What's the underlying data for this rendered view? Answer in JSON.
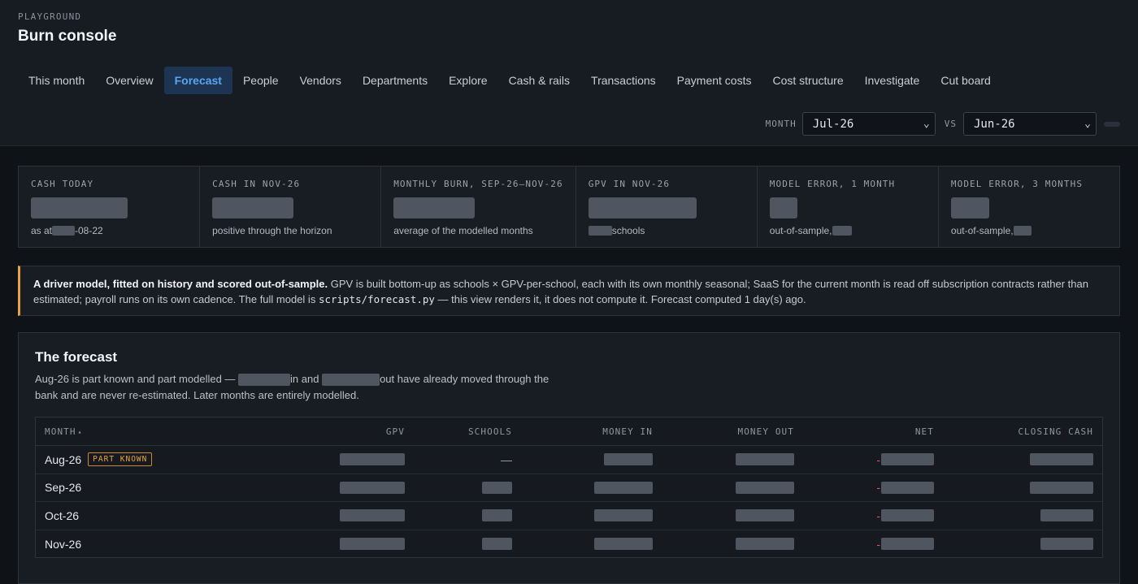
{
  "header": {
    "eyebrow": "PLAYGROUND",
    "title": "Burn console"
  },
  "nav": {
    "tabs": [
      "This month",
      "Overview",
      "Forecast",
      "People",
      "Vendors",
      "Departments",
      "Explore",
      "Cash & rails",
      "Transactions",
      "Payment costs",
      "Cost structure",
      "Investigate",
      "Cut board"
    ],
    "active": "Forecast"
  },
  "filters": {
    "month_label": "MONTH",
    "month_value": "Jul-26",
    "vs_label": "VS",
    "vs_value": "Jun-26"
  },
  "metrics": [
    {
      "label": "CASH TODAY",
      "sub_pre": "as at ",
      "sub_post": "-08-22"
    },
    {
      "label": "CASH IN NOV-26",
      "sub_pre": "positive through the horizon",
      "sub_post": ""
    },
    {
      "label": "MONTHLY BURN, SEP-26–NOV-26",
      "sub_pre": "average of the modelled months",
      "sub_post": ""
    },
    {
      "label": "GPV IN NOV-26",
      "sub_pre": "",
      "sub_post": " schools"
    },
    {
      "label": "MODEL ERROR, 1 MONTH",
      "sub_pre": "out-of-sample, ",
      "sub_post": ""
    },
    {
      "label": "MODEL ERROR, 3 MONTHS",
      "sub_pre": "out-of-sample, ",
      "sub_post": ""
    }
  ],
  "note": {
    "lead": "A driver model, fitted on history and scored out-of-sample.",
    "body1": " GPV is built bottom-up as schools × GPV-per-school, each with its own monthly seasonal; SaaS for the current month is read off subscription contracts rather than estimated; payroll runs on its own cadence. The full model is ",
    "code": "scripts/forecast.py",
    "body2": " — this view renders it, it does not compute it. Forecast computed 1 day(s) ago."
  },
  "forecast": {
    "title": "The forecast",
    "desc_1": "Aug-26 is part known and part modelled — ",
    "desc_2": "in and ",
    "desc_3": "out have already moved through the bank and are never re-estimated. Later months are entirely modelled.",
    "columns": [
      "MONTH",
      "GPV",
      "SCHOOLS",
      "MONEY IN",
      "MONEY OUT",
      "NET",
      "CLOSING CASH"
    ],
    "sort_icon": "▴",
    "rows": [
      {
        "month": "Aug-26",
        "badge": "PART KNOWN",
        "schools": "—",
        "net_sign": "-"
      },
      {
        "month": "Sep-26",
        "badge": "",
        "schools": "",
        "net_sign": "-"
      },
      {
        "month": "Oct-26",
        "badge": "",
        "schools": "",
        "net_sign": "-"
      },
      {
        "month": "Nov-26",
        "badge": "",
        "schools": "",
        "net_sign": "-"
      }
    ]
  }
}
